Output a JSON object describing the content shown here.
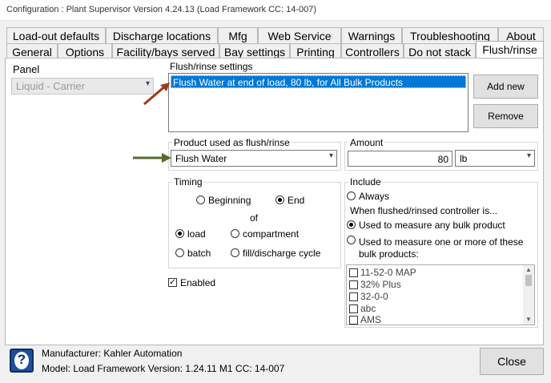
{
  "window": {
    "title": "Configuration : Plant Supervisor Version 4.24.13 (Load Framework CC: 14-007)"
  },
  "tabs_row1": [
    "Load-out defaults",
    "Discharge locations",
    "Mfg",
    "Web Service",
    "Warnings",
    "Troubleshooting",
    "About"
  ],
  "tabs_row2": [
    "General",
    "Options",
    "Facility/bays served",
    "Bay settings",
    "Printing",
    "Controllers",
    "Do not stack",
    "Flush/rinse"
  ],
  "panel": {
    "label": "Panel",
    "selected": "Liquid - Carrier"
  },
  "flush_settings": {
    "label": "Flush/rinse settings",
    "items": [
      "Flush Water at end of load, 80 lb, for All Bulk Products"
    ],
    "add_new": "Add new",
    "remove": "Remove"
  },
  "product": {
    "label": "Product used as flush/rinse",
    "selected": "Flush Water"
  },
  "amount": {
    "label": "Amount",
    "value": "80",
    "unit": "lb"
  },
  "timing": {
    "label": "Timing",
    "beginning": "Beginning",
    "end": "End",
    "of": "of",
    "load": "load",
    "compartment": "compartment",
    "batch": "batch",
    "fill_discharge": "fill/discharge cycle"
  },
  "enabled": {
    "label": "Enabled",
    "checked": true
  },
  "include": {
    "label": "Include",
    "always": "Always",
    "when_text": "When flushed/rinsed controller is...",
    "any": "Used to measure any bulk product",
    "one_or_more": "Used to measure one or more of these bulk products:",
    "one_or_more_line1": "Used to measure one or more of these",
    "one_or_more_line2": "bulk products:",
    "products": [
      "11-52-0 MAP",
      "32% Plus",
      "32-0-0",
      "abc",
      "AMS"
    ]
  },
  "footer": {
    "manufacturer": "Manufacturer: Kahler Automation",
    "model": "Model: Load Framework Version: 1.24.11 M1 CC: 14-007",
    "close": "Close",
    "help_glyph": "?"
  },
  "colors": {
    "selection": "#0078d7",
    "arrow": "#a0381c",
    "arrow_green": "#556b2f"
  }
}
